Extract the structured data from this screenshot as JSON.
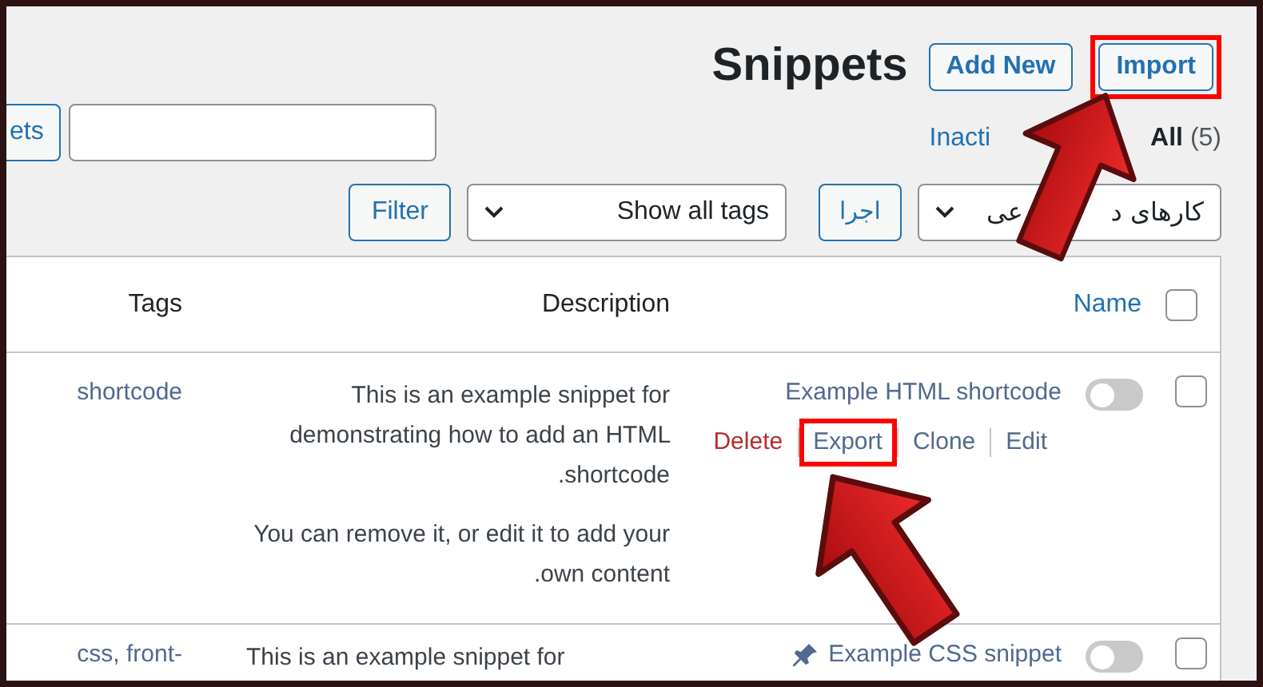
{
  "header": {
    "title": "Snippets",
    "buttons": [
      {
        "label": "Add New",
        "highlighted": false
      },
      {
        "label": "Import",
        "highlighted": true
      }
    ]
  },
  "search": {
    "button": "ets"
  },
  "views": [
    {
      "label": "Inacti",
      "selected": false
    },
    {
      "label": "All",
      "count": "(5)",
      "selected": true
    }
  ],
  "filters": {
    "filter_button": "Filter",
    "tags_select": "Show all tags",
    "apply_button": "اجرا",
    "bulk_select_parts": [
      "کارهای د",
      "عی"
    ]
  },
  "table": {
    "select_all": {
      "checked": false
    },
    "columns": [
      {
        "label": "Tags",
        "kind": "text"
      },
      {
        "label": "Description",
        "kind": "text"
      },
      {
        "label": "Name",
        "kind": "sortable"
      }
    ],
    "rows": [
      {
        "tags": "shortcode",
        "description": [
          "This is an example snippet for demonstrating how to add an HTML shortcode.",
          "You can remove it, or edit it to add your own content."
        ],
        "name": "Example HTML shortcode",
        "kind": "html",
        "active": false,
        "checked": false,
        "actions": [
          {
            "label": "Delete",
            "kind": "danger",
            "highlighted": false
          },
          {
            "label": "Export",
            "kind": "link",
            "highlighted": true
          },
          {
            "label": "Clone",
            "kind": "link",
            "highlighted": false
          },
          {
            "label": "Edit",
            "kind": "link",
            "highlighted": false
          }
        ]
      },
      {
        "tags": "css, front-",
        "description": [
          "This is an example snippet for"
        ],
        "name": "Example CSS snippet",
        "kind": "css",
        "active": false,
        "checked": false,
        "actions": []
      }
    ]
  }
}
